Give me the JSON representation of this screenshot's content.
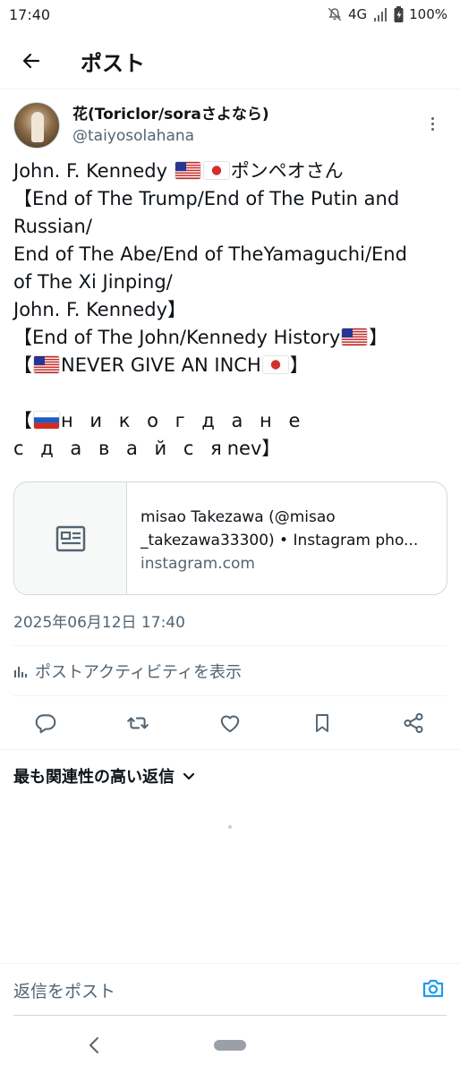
{
  "status_bar": {
    "time": "17:40",
    "network": "4G",
    "battery": "100%",
    "icons": [
      "mute-icon",
      "signal-icon",
      "battery-icon"
    ]
  },
  "header": {
    "title": "ポスト",
    "back_icon": "arrow-left-icon"
  },
  "post": {
    "author": {
      "display_name": "花(Toriclor/soraさよなら)",
      "handle": "@taiyosolahana"
    },
    "lines": {
      "l1_a": "John. F. Kennedy ",
      "l1_b": "ポンペオさん",
      "l2": "【End of The Trump/End of The Putin and",
      "l3": "Russian/",
      "l4": "End of The Abe/End of TheYamaguchi/End",
      "l5": "of The Xi Jinping/",
      "l6": "John. F. Kennedy】",
      "l7_a": "【End of The John/Kennedy History",
      "l7_b": "】",
      "l8_a": "【",
      "l8_b": "NEVER GIVE AN INCH",
      "l8_c": "】",
      "l9_a": "【",
      "l9_b": "н и к о г д а н е",
      "l10_a": "с д а в а й с я",
      "l10_b": "nev】"
    },
    "link_card": {
      "title_line1": "misao Takezawa (@misao",
      "title_line2": "_takezawa33300) • Instagram pho...",
      "domain": "instagram.com",
      "icon": "article-icon"
    },
    "timestamp": "2025年06月12日 17:40",
    "activity_label": "ポストアクティビティを表示",
    "actions": [
      "reply-icon",
      "repost-icon",
      "like-icon",
      "bookmark-icon",
      "share-icon"
    ]
  },
  "replies": {
    "sort_label": "最も関連性の高い返信"
  },
  "composer": {
    "placeholder": "返信をポスト",
    "camera_icon": "camera-icon"
  },
  "colors": {
    "text": "#0f1419",
    "secondary": "#536471",
    "accent": "#1d9bf0",
    "divider": "#eff3f4"
  }
}
